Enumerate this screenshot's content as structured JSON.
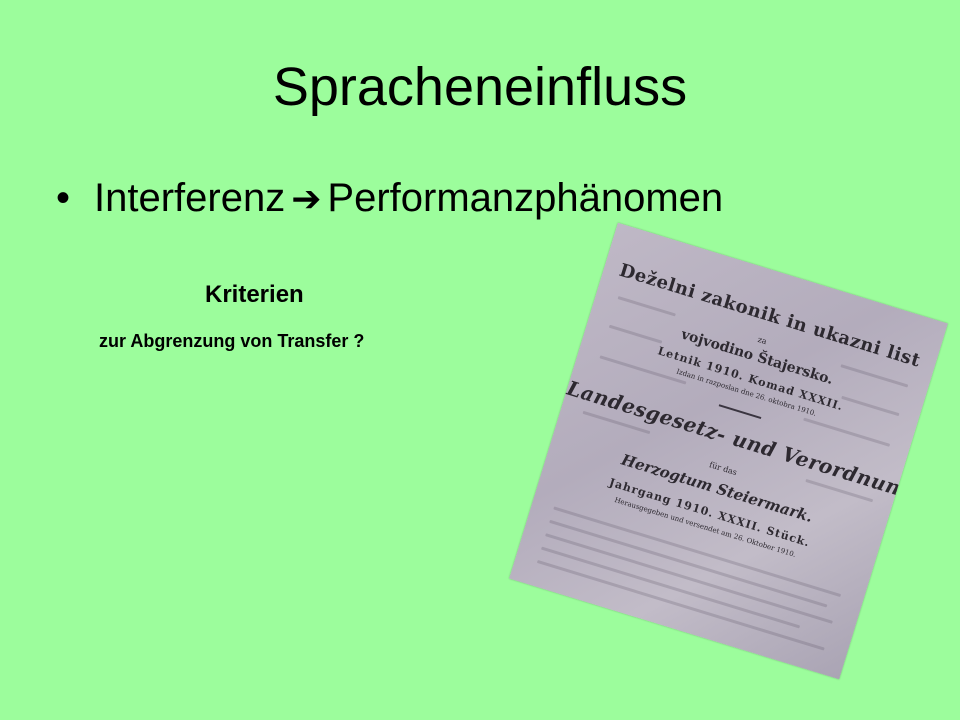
{
  "slide": {
    "title": "Spracheneinfluss",
    "bullet": {
      "marker": "•",
      "left_text": "Interferenz",
      "arrow": "➔",
      "right_text": "Performanzphänomen"
    },
    "subheading": "Kriterien",
    "subtext": "zur Abgrenzung von Transfer ?"
  },
  "document_photo": {
    "heading": "Deželni zakonik in ukazni list",
    "heading_na": "za",
    "region": "vojvodino Štajersko.",
    "year_line": "Letnik 1910.   Komad XXXII.",
    "issued_line": "Izdan in razposlan dne 26. oktobra 1910.",
    "german_title": "Landesgesetz- und Verordnungsblatt",
    "german_fuer": "für das",
    "duchy": "Herzogtum Steiermark.",
    "jahrgang": "Jahrgang 1910.   XXXII. Stück.",
    "published_line": "Herausgegeben und versendet am 26. Oktober 1910."
  },
  "colors": {
    "background": "#9cfd9c",
    "text": "#000000",
    "paper": "#bab3c2"
  }
}
